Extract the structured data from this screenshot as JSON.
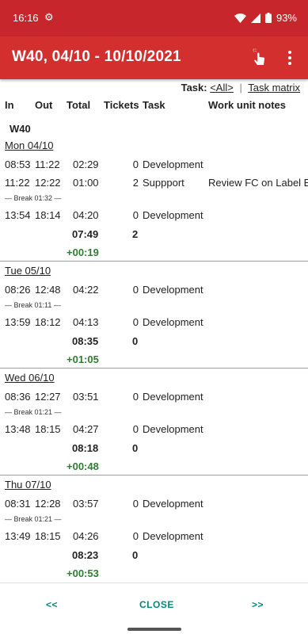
{
  "status_bar": {
    "time": "16:16",
    "battery": "93%",
    "icons": [
      "gear-icon",
      "wifi-icon",
      "signal-icon",
      "battery-icon"
    ]
  },
  "app_bar": {
    "title": "W40, 04/10 - 10/10/2021",
    "tap_icon": "tap-gesture-icon",
    "more_icon": "more-vert-icon"
  },
  "task_filter": {
    "label": "Task:",
    "current": "<All>",
    "separator": "|",
    "matrix_link": "Task matrix"
  },
  "columns": [
    "In",
    "Out",
    "Total",
    "Tickets",
    "Task",
    "Work unit notes"
  ],
  "week_label": "W40",
  "days": [
    {
      "label": "Mon 04/10",
      "entries": [
        {
          "in": "08:53",
          "out": "11:22",
          "total": "02:29",
          "tickets": "0",
          "task": "Development",
          "notes": ""
        },
        {
          "in": "11:22",
          "out": "12:22",
          "total": "01:00",
          "tickets": "2",
          "task": "Suppport",
          "notes": "Review FC on Label E"
        },
        {
          "break": "— Break 01:32 —"
        },
        {
          "in": "13:54",
          "out": "18:14",
          "total": "04:20",
          "tickets": "0",
          "task": "Development",
          "notes": ""
        }
      ],
      "sum_total": "07:49",
      "sum_tickets": "2",
      "overtime": "+00:19"
    },
    {
      "label": "Tue 05/10",
      "entries": [
        {
          "in": "08:26",
          "out": "12:48",
          "total": "04:22",
          "tickets": "0",
          "task": "Development",
          "notes": ""
        },
        {
          "break": "— Break 01:11 —"
        },
        {
          "in": "13:59",
          "out": "18:12",
          "total": "04:13",
          "tickets": "0",
          "task": "Development",
          "notes": ""
        }
      ],
      "sum_total": "08:35",
      "sum_tickets": "0",
      "overtime": "+01:05"
    },
    {
      "label": "Wed 06/10",
      "entries": [
        {
          "in": "08:36",
          "out": "12:27",
          "total": "03:51",
          "tickets": "0",
          "task": "Development",
          "notes": ""
        },
        {
          "break": "— Break 01:21 —"
        },
        {
          "in": "13:48",
          "out": "18:15",
          "total": "04:27",
          "tickets": "0",
          "task": "Development",
          "notes": ""
        }
      ],
      "sum_total": "08:18",
      "sum_tickets": "0",
      "overtime": "+00:48"
    },
    {
      "label": "Thu 07/10",
      "entries": [
        {
          "in": "08:31",
          "out": "12:28",
          "total": "03:57",
          "tickets": "0",
          "task": "Development",
          "notes": ""
        },
        {
          "break": "— Break 01:21 —"
        },
        {
          "in": "13:49",
          "out": "18:15",
          "total": "04:26",
          "tickets": "0",
          "task": "Development",
          "notes": ""
        }
      ],
      "sum_total": "08:23",
      "sum_tickets": "0",
      "overtime": "+00:53"
    }
  ],
  "bottom_bar": {
    "prev": "<<",
    "close": "CLOSE",
    "next": ">>"
  },
  "colors": {
    "status_bar": "#c7262c",
    "app_bar": "#d32f2f",
    "overtime": "#2e7d32",
    "button": "#00897b"
  }
}
